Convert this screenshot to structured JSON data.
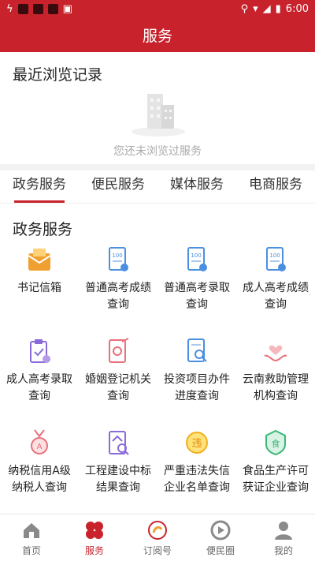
{
  "status_bar": {
    "time": "6:00"
  },
  "header": {
    "title": "服务"
  },
  "recent": {
    "title": "最近浏览记录",
    "empty_text": "您还未浏览过服务"
  },
  "tabs": [
    {
      "label": "政务服务",
      "active": true
    },
    {
      "label": "便民服务",
      "active": false
    },
    {
      "label": "媒体服务",
      "active": false
    },
    {
      "label": "电商服务",
      "active": false
    }
  ],
  "section": {
    "title": "政务服务"
  },
  "services": [
    {
      "label": "书记信箱",
      "icon": "mailbox-icon"
    },
    {
      "label": "普通高考成绩查询",
      "icon": "score-doc-icon"
    },
    {
      "label": "普通高考录取查询",
      "icon": "admission-doc-icon"
    },
    {
      "label": "成人高考成绩查询",
      "icon": "adult-score-doc-icon"
    },
    {
      "label": "成人高考录取查询",
      "icon": "clipboard-icon"
    },
    {
      "label": "婚姻登记机关查询",
      "icon": "marriage-cert-icon"
    },
    {
      "label": "投资项目办件进度查询",
      "icon": "search-doc-icon"
    },
    {
      "label": "云南救助管理机构查询",
      "icon": "helping-hands-icon"
    },
    {
      "label": "纳税信用A级纳税人查询",
      "icon": "medal-icon"
    },
    {
      "label": "工程建设中标结果查询",
      "icon": "building-search-icon"
    },
    {
      "label": "严重违法失信企业名单查询",
      "icon": "violation-icon"
    },
    {
      "label": "食品生产许可获证企业查询",
      "icon": "food-license-icon"
    }
  ],
  "bottom_nav": [
    {
      "label": "首页",
      "icon": "home-icon",
      "active": false
    },
    {
      "label": "服务",
      "icon": "service-icon",
      "active": true
    },
    {
      "label": "订阅号",
      "icon": "subscription-icon",
      "active": false
    },
    {
      "label": "便民圈",
      "icon": "play-circle-icon",
      "active": false
    },
    {
      "label": "我的",
      "icon": "person-icon",
      "active": false
    }
  ],
  "colors": {
    "brand": "#c8232c",
    "icon_orange": "#f0a030",
    "icon_blue": "#4a8fe0",
    "icon_purple": "#8a6ad8",
    "icon_red": "#e8707a",
    "icon_green": "#3cb878",
    "icon_yellow": "#f0b020"
  }
}
